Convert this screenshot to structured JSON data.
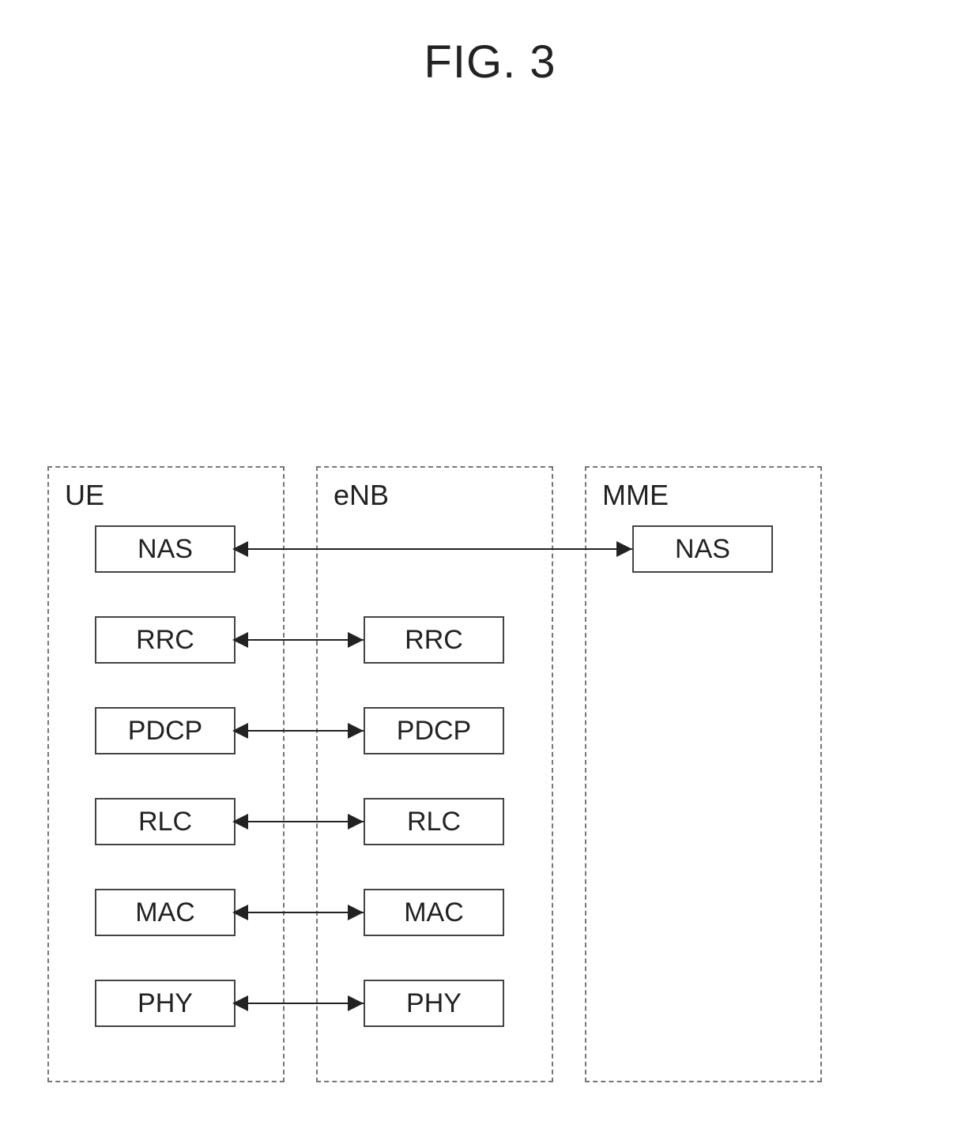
{
  "title": "FIG. 3",
  "containers": {
    "ue": {
      "label": "UE"
    },
    "enb": {
      "label": "eNB"
    },
    "mme": {
      "label": "MME"
    }
  },
  "layers": {
    "nas": "NAS",
    "rrc": "RRC",
    "pdcp": "PDCP",
    "rlc": "RLC",
    "mac": "MAC",
    "phy": "PHY"
  }
}
